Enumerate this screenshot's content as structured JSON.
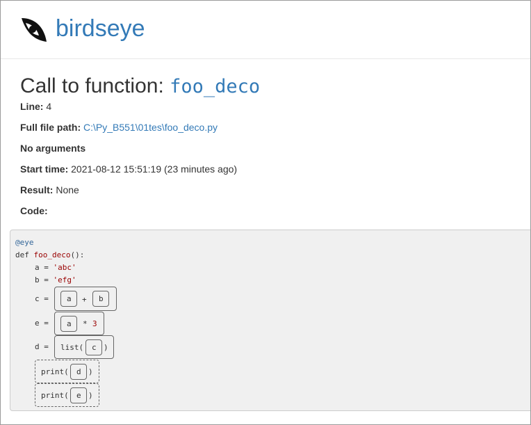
{
  "brand": {
    "name": "birdseye"
  },
  "page": {
    "title_prefix": "Call to function:",
    "function_name": "foo_deco"
  },
  "meta": {
    "line_label": "Line:",
    "line_value": "4",
    "path_label": "Full file path:",
    "path_value": "C:\\Py_B551\\01tes\\foo_deco.py",
    "args_label": "No arguments",
    "start_label": "Start time:",
    "start_value": "2021-08-12 15:51:19 (23 minutes ago)",
    "result_label": "Result:",
    "result_value": "None",
    "code_label": "Code:"
  },
  "code": {
    "decorator": "@eye",
    "def_kw": "def",
    "func": "foo_deco",
    "def_tail": "():",
    "line_a_lhs": "a = ",
    "line_a_val": "'abc'",
    "line_b_lhs": "b = ",
    "line_b_val": "'efg'",
    "line_c_lhs": "c = ",
    "c_left": "a",
    "c_op": "+",
    "c_right": "b",
    "line_e_lhs": "e = ",
    "e_left": "a",
    "e_op": "*",
    "e_num": "3",
    "line_d_lhs": "d = ",
    "d_call": "list(",
    "d_arg": "c",
    "d_close": ")",
    "print1_call": "print(",
    "print1_arg": "d",
    "print1_close": ")",
    "print2_call": "print(",
    "print2_arg": "e",
    "print2_close": ")"
  }
}
